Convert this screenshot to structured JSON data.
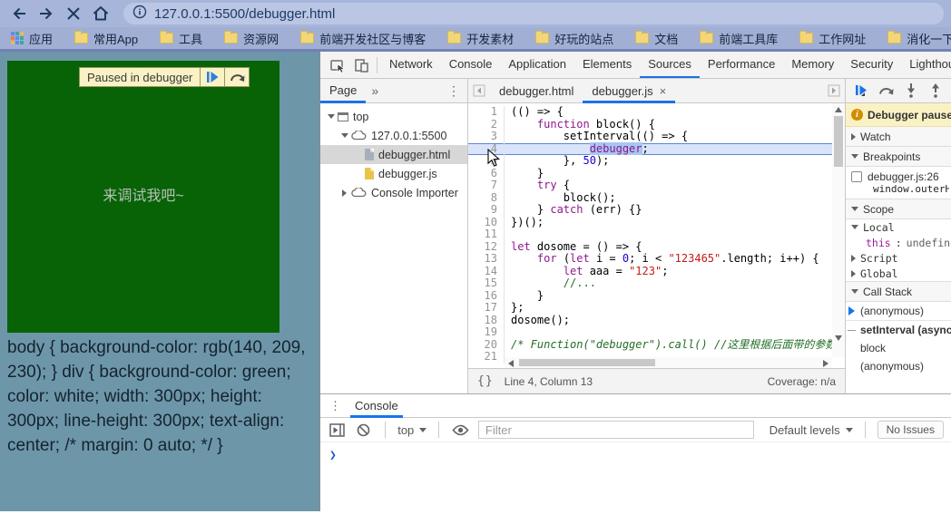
{
  "browser": {
    "url": "127.0.0.1:5500/debugger.html",
    "bookmarks": [
      {
        "label": "应用",
        "icon": "apps-grid-icon"
      },
      {
        "label": "常用App",
        "icon": "folder-icon"
      },
      {
        "label": "工具",
        "icon": "folder-icon"
      },
      {
        "label": "资源网",
        "icon": "folder-icon"
      },
      {
        "label": "前端开发社区与博客",
        "icon": "folder-icon"
      },
      {
        "label": "开发素材",
        "icon": "folder-icon"
      },
      {
        "label": "好玩的站点",
        "icon": "folder-icon"
      },
      {
        "label": "文档",
        "icon": "folder-icon"
      },
      {
        "label": "前端工具库",
        "icon": "folder-icon"
      },
      {
        "label": "工作网址",
        "icon": "folder-icon"
      },
      {
        "label": "消化一下",
        "icon": "folder-icon"
      }
    ]
  },
  "page": {
    "paused_banner_label": "Paused in debugger",
    "box_text": "来调试我吧~",
    "css_text": "body { background-color: rgb(140, 209, 230); } div { background-color: green; color: white; width: 300px; height: 300px; line-height: 300px; text-align: center; /* margin: 0 auto; */ }"
  },
  "devtools": {
    "panel_tabs": {
      "items": [
        "Network",
        "Console",
        "Application",
        "Elements",
        "Sources",
        "Performance",
        "Memory",
        "Security",
        "Lighthouse"
      ],
      "active": "Sources"
    },
    "navigator": {
      "tab_label": "Page",
      "more_tabs_glyph": "»",
      "menu_glyph": "⋮",
      "tree": [
        {
          "label": "top",
          "icon": "frame-icon",
          "depth": 0,
          "expander": "open"
        },
        {
          "label": "127.0.0.1:5500",
          "icon": "cloud-icon",
          "depth": 1,
          "expander": "open"
        },
        {
          "label": "debugger.html",
          "icon": "file-html-icon",
          "depth": 2,
          "expander": "none",
          "selected": true
        },
        {
          "label": "debugger.js",
          "icon": "file-js-icon",
          "depth": 2,
          "expander": "none"
        },
        {
          "label": "Console Importer",
          "icon": "cloud-icon",
          "depth": 1,
          "expander": "closed"
        }
      ]
    },
    "editor": {
      "tabs": [
        {
          "label": "debugger.html",
          "active": false,
          "closable": false
        },
        {
          "label": "debugger.js",
          "active": true,
          "closable": true,
          "close_glyph": "×"
        }
      ],
      "paused_line": 4,
      "lines": [
        {
          "n": 1,
          "t": [
            [
              "p",
              "(() => {"
            ]
          ]
        },
        {
          "n": 2,
          "t": [
            [
              "p",
              "    "
            ],
            [
              "kw",
              "function"
            ],
            [
              "p",
              " block() {"
            ]
          ]
        },
        {
          "n": 3,
          "t": [
            [
              "p",
              "        setInterval(() => {"
            ]
          ]
        },
        {
          "n": 4,
          "t": [
            [
              "p",
              "            "
            ],
            [
              "kwh",
              "debugger"
            ],
            [
              "p",
              ";"
            ]
          ]
        },
        {
          "n": 5,
          "t": [
            [
              "p",
              "        }, "
            ],
            [
              "num",
              "50"
            ],
            [
              "p",
              ");"
            ]
          ]
        },
        {
          "n": 6,
          "t": [
            [
              "p",
              "    }"
            ]
          ]
        },
        {
          "n": 7,
          "t": [
            [
              "p",
              "    "
            ],
            [
              "kw",
              "try"
            ],
            [
              "p",
              " {"
            ]
          ]
        },
        {
          "n": 8,
          "t": [
            [
              "p",
              "        block();"
            ]
          ]
        },
        {
          "n": 9,
          "t": [
            [
              "p",
              "    } "
            ],
            [
              "kw",
              "catch"
            ],
            [
              "p",
              " (err) {}"
            ]
          ]
        },
        {
          "n": 10,
          "t": [
            [
              "p",
              "})();"
            ]
          ]
        },
        {
          "n": 11,
          "t": []
        },
        {
          "n": 12,
          "t": [
            [
              "kw",
              "let"
            ],
            [
              "p",
              " dosome = () => {"
            ]
          ]
        },
        {
          "n": 13,
          "t": [
            [
              "p",
              "    "
            ],
            [
              "kw",
              "for"
            ],
            [
              "p",
              " ("
            ],
            [
              "kw",
              "let"
            ],
            [
              "p",
              " i = "
            ],
            [
              "num",
              "0"
            ],
            [
              "p",
              "; i < "
            ],
            [
              "str",
              "\"123465\""
            ],
            [
              "p",
              ".length; i++) {"
            ]
          ]
        },
        {
          "n": 14,
          "t": [
            [
              "p",
              "        "
            ],
            [
              "kw",
              "let"
            ],
            [
              "p",
              " aaa = "
            ],
            [
              "str",
              "\"123\""
            ],
            [
              "p",
              ";"
            ]
          ]
        },
        {
          "n": 15,
          "t": [
            [
              "p",
              "        "
            ],
            [
              "cmt",
              "//..."
            ]
          ]
        },
        {
          "n": 16,
          "t": [
            [
              "p",
              "    }"
            ]
          ]
        },
        {
          "n": 17,
          "t": [
            [
              "p",
              "};"
            ]
          ]
        },
        {
          "n": 18,
          "t": [
            [
              "p",
              "dosome();"
            ]
          ]
        },
        {
          "n": 19,
          "t": []
        },
        {
          "n": 20,
          "t": [
            [
              "cmti",
              "/* Function(\"debugger\").call() //这里根据后面带的参数个"
            ]
          ]
        },
        {
          "n": 21,
          "t": []
        }
      ],
      "status": {
        "brackets_glyph": "{}",
        "position": "Line 4, Column 13",
        "coverage": "Coverage: n/a"
      }
    },
    "debugger_sidebar": {
      "paused_message": "Debugger paused",
      "watch_title": "Watch",
      "breakpoints_title": "Breakpoints",
      "breakpoints": [
        {
          "location": "debugger.js:26",
          "snippet": "window.outerHeight",
          "checked": false
        }
      ],
      "scope_title": "Scope",
      "scope_groups": [
        {
          "label": "Local",
          "expanded": true,
          "vars": [
            {
              "name": "this",
              "value": "undefined"
            }
          ]
        },
        {
          "label": "Script",
          "expanded": false,
          "vars": []
        },
        {
          "label": "Global",
          "expanded": false,
          "vars": []
        }
      ],
      "call_stack_title": "Call Stack",
      "call_stack": [
        {
          "label": "(anonymous)",
          "current": true,
          "async_boundary": false
        },
        {
          "label": "setInterval (async)",
          "current": false,
          "async_boundary": true
        },
        {
          "label": "block",
          "current": false,
          "async_boundary": false
        },
        {
          "label": "(anonymous)",
          "current": false,
          "async_boundary": false
        }
      ]
    },
    "console_drawer": {
      "menu_glyph": "⋮",
      "tab_label": "Console",
      "context_label": "top",
      "filter_placeholder": "Filter",
      "levels_label": "Default levels",
      "no_issues_label": "No Issues",
      "prompt_glyph": "❯"
    }
  },
  "colors": {
    "accent_blue": "#1a73e8",
    "paused_banner_bg": "#fbf2c4",
    "page_dim_bg": "#6d96a9",
    "box_green": "#086307",
    "paused_line_bg": "#d9e4fb",
    "syntax_keyword": "#8e188e",
    "syntax_string": "#c41a16",
    "syntax_number": "#1c00cf",
    "syntax_comment": "#236e25"
  }
}
